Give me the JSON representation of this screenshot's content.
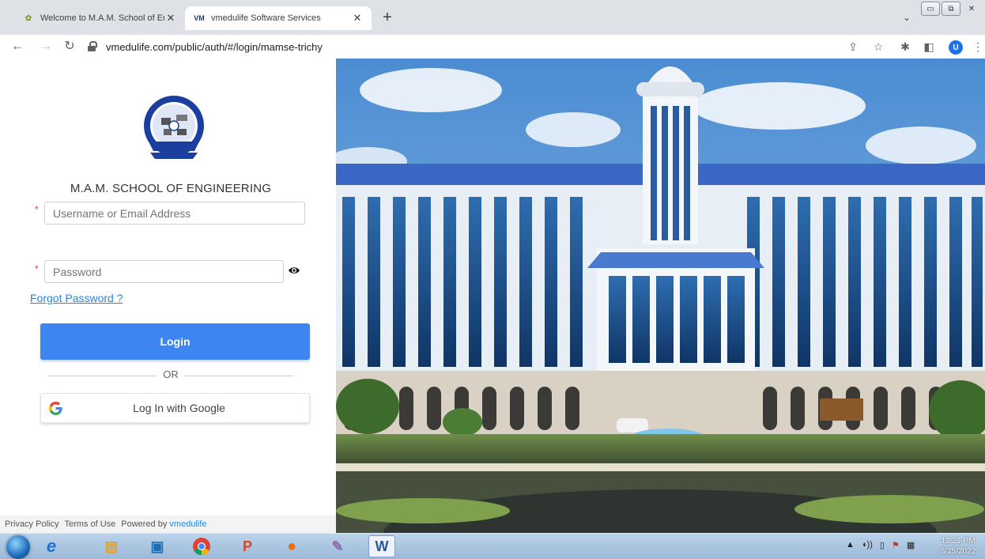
{
  "browser": {
    "tabs": [
      {
        "title": "Welcome to M.A.M. School of En",
        "active": false
      },
      {
        "title": "vmedulife Software Services",
        "active": true
      }
    ],
    "new_tab_label": "+",
    "url": "vmedulife.com/public/auth/#/login/mamse-trichy",
    "profile_initial": "U"
  },
  "login": {
    "school_name": "M.A.M. SCHOOL OF ENGINEERING",
    "username_placeholder": "Username or Email Address",
    "password_placeholder": "Password",
    "required_mark": "*",
    "forgot_label": "Forgot Password ?",
    "login_label": "Login",
    "or_label": "OR",
    "google_label": "Log In with Google"
  },
  "footer": {
    "privacy": "Privacy Policy",
    "terms": "Terms of Use",
    "powered": "Powered by",
    "brand": "vmedulife"
  },
  "taskbar": {
    "time": "12:21 PM",
    "date": "8/25/2022"
  },
  "colors": {
    "accent": "#3d86f2",
    "link": "#1e88e5",
    "required": "#e53935"
  }
}
